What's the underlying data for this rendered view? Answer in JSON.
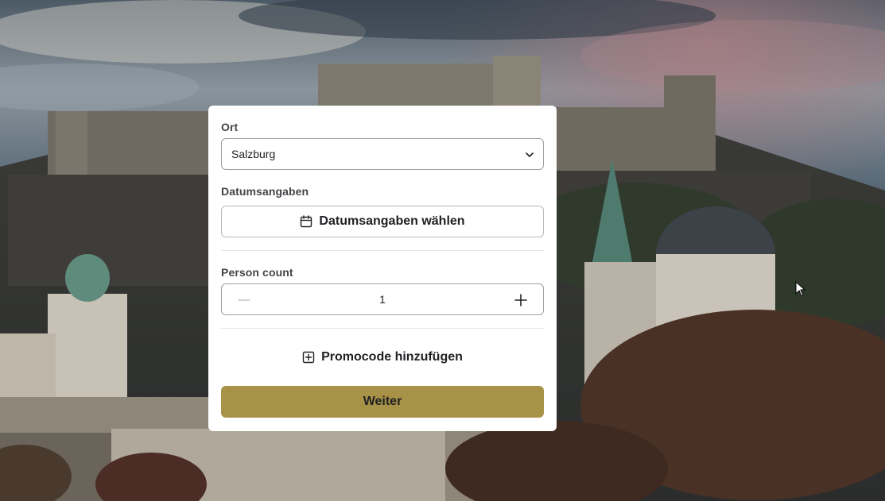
{
  "form": {
    "location_label": "Ort",
    "location_value": "Salzburg",
    "dates_label": "Datumsangaben",
    "dates_button": "Datumsangaben wählen",
    "person_label": "Person count",
    "person_value": "1",
    "promo_button": "Promocode hinzufügen",
    "submit_button": "Weiter"
  },
  "colors": {
    "accent": "#a89248",
    "card": "#ffffff",
    "border": "#9aa0a6"
  },
  "icons": {
    "location_dropdown": "chevron-down-icon",
    "dates": "calendar-icon",
    "decrement": "minus-icon",
    "increment": "plus-icon",
    "promo": "plus-square-icon"
  }
}
